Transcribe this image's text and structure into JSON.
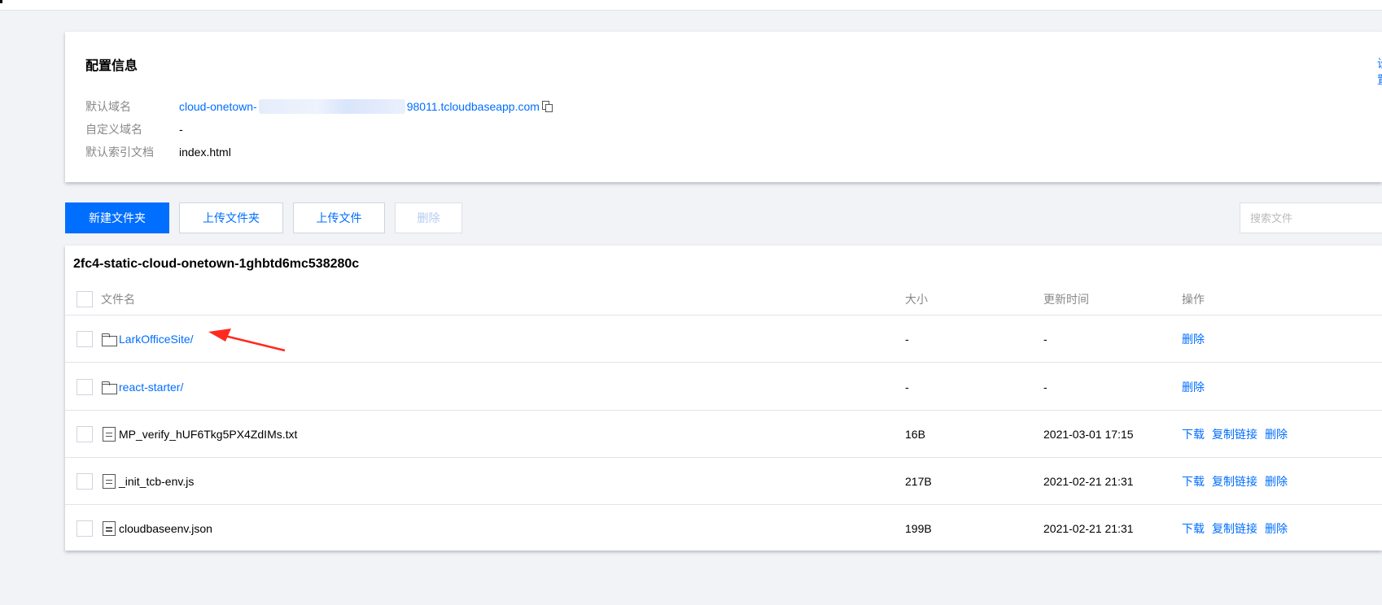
{
  "config": {
    "title": "配置信息",
    "edit_label": "设置",
    "rows": [
      {
        "label": "默认域名",
        "value_prefix": "cloud-onetown-",
        "value_suffix": "98011.tcloudbaseapp.com"
      },
      {
        "label": "自定义域名",
        "value": "-"
      },
      {
        "label": "默认索引文档",
        "value": "index.html"
      }
    ]
  },
  "toolbar": {
    "new_folder": "新建文件夹",
    "upload_folder": "上传文件夹",
    "upload_file": "上传文件",
    "delete": "删除",
    "search_placeholder": "搜索文件"
  },
  "files": {
    "bucket": "2fc4-static-cloud-onetown-1ghbtd6mc538280c",
    "columns": {
      "name": "文件名",
      "size": "大小",
      "time": "更新时间",
      "ops": "操作"
    },
    "rows": [
      {
        "name": "LarkOfficeSite/",
        "size": "-",
        "time": "-",
        "type": "folder",
        "ops": [
          "删除"
        ]
      },
      {
        "name": "react-starter/",
        "size": "-",
        "time": "-",
        "type": "folder",
        "ops": [
          "删除"
        ]
      },
      {
        "name": "MP_verify_hUF6Tkg5PX4ZdIMs.txt",
        "size": "16B",
        "time": "2021-03-01 17:15",
        "type": "file",
        "ops": [
          "下载",
          "复制链接",
          "删除"
        ]
      },
      {
        "name": "_init_tcb-env.js",
        "size": "217B",
        "time": "2021-02-21 21:31",
        "type": "file",
        "ops": [
          "下载",
          "复制链接",
          "删除"
        ]
      },
      {
        "name": "cloudbaseenv.json",
        "size": "199B",
        "time": "2021-02-21 21:31",
        "type": "file",
        "ops": [
          "下载",
          "复制链接",
          "删除"
        ]
      }
    ]
  },
  "colors": {
    "accent": "#006eff",
    "annotation": "#ff2a1f"
  }
}
